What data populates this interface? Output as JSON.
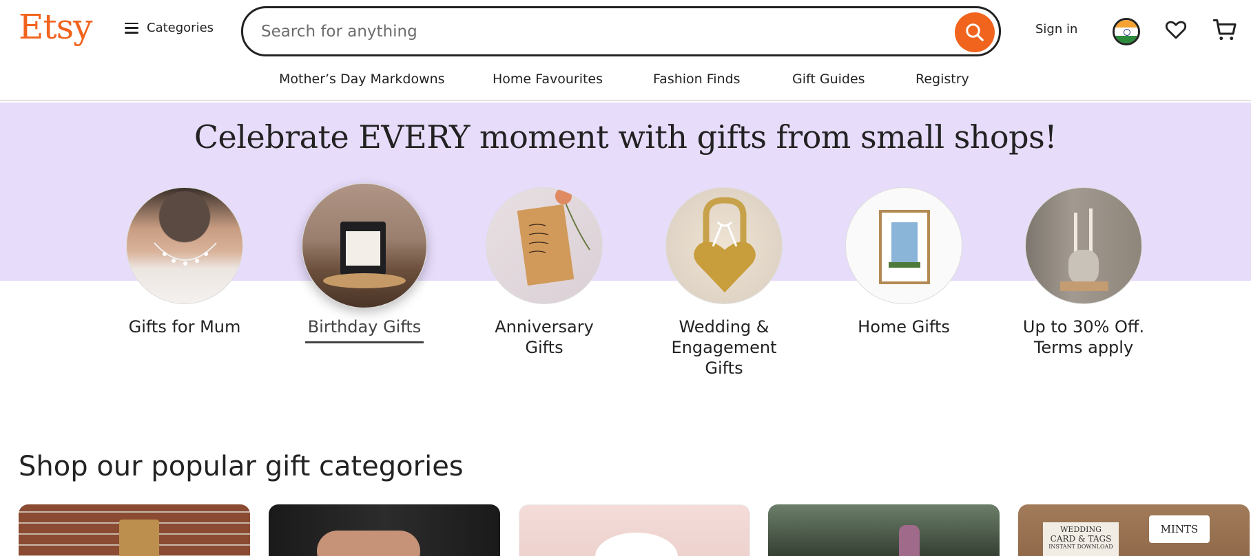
{
  "header": {
    "logo": "Etsy",
    "categories_label": "Categories",
    "search_placeholder": "Search for anything",
    "signin_label": "Sign in"
  },
  "nav": {
    "items": [
      "Mother’s Day Markdowns",
      "Home Favourites",
      "Fashion Finds",
      "Gift Guides",
      "Registry"
    ]
  },
  "banner": {
    "title": "Celebrate EVERY moment with gifts from small shops!",
    "categories": [
      {
        "line1": "Gifts for Mum",
        "line2": "",
        "line3": ""
      },
      {
        "line1": "Birthday Gifts",
        "line2": "",
        "line3": ""
      },
      {
        "line1": "Anniversary",
        "line2": "Gifts",
        "line3": ""
      },
      {
        "line1": "Wedding &",
        "line2": "Engagement",
        "line3": "Gifts"
      },
      {
        "line1": "Home Gifts",
        "line2": "",
        "line3": ""
      },
      {
        "line1": "Up to 30% Off.",
        "line2": "Terms apply",
        "line3": ""
      }
    ]
  },
  "section": {
    "title": "Shop our popular gift categories"
  },
  "cards": {
    "wedding_card_line1": "WEDDING",
    "wedding_card_line2": "CARD & TAGS",
    "wedding_card_line3": "INSTANT DOWNLOAD",
    "mints_label": "MINTS"
  },
  "colors": {
    "brand": "#f1641e",
    "banner_bg": "#e8dcfb"
  }
}
